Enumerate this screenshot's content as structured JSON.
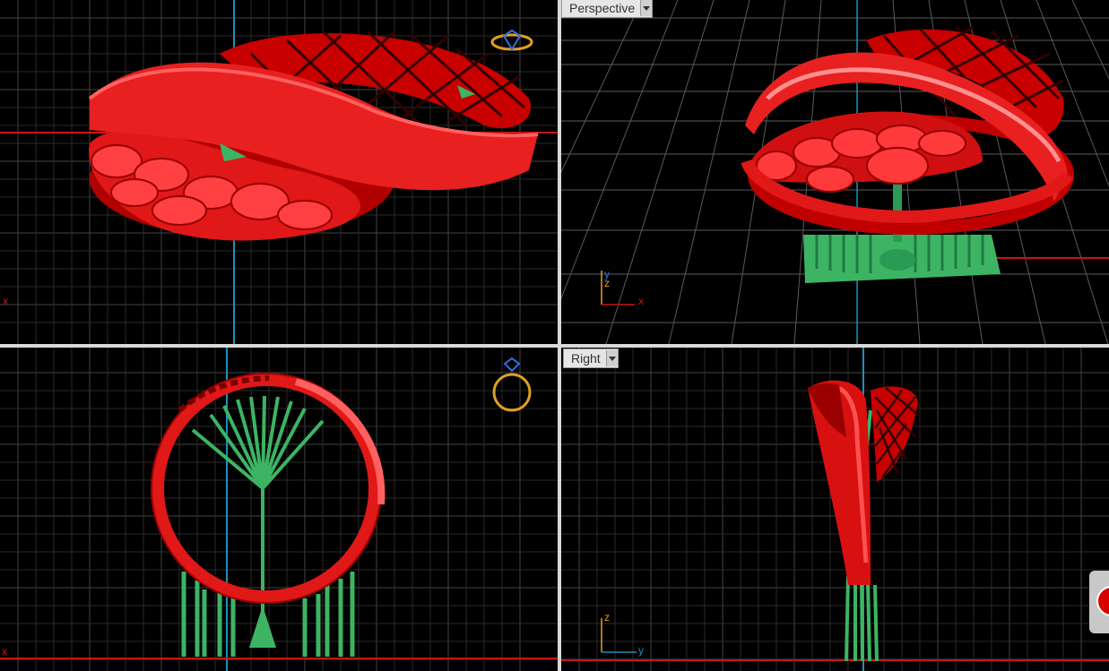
{
  "viewports": {
    "top": {
      "label": ""
    },
    "perspective": {
      "label": "Perspective"
    },
    "front": {
      "label": ""
    },
    "right": {
      "label": "Right"
    }
  },
  "axis_labels": {
    "persp_y": "y",
    "persp_z": "z",
    "persp_x": "x",
    "right_z": "z",
    "right_y": "y",
    "top_x": "x",
    "front_x": "x"
  },
  "colors": {
    "background": "#000000",
    "grid": "#4a4a4a",
    "model": "#e01010",
    "supports": "#3cb464",
    "accent_axis": "#1e8fb8",
    "axis_red": "#c81414",
    "gizmo_gold": "#e0a020",
    "gizmo_blue": "#3070e0"
  },
  "icons": {
    "viewport_menu": "chevron-down-icon",
    "gizmo": "ring-gizmo-icon",
    "side": "record-button-icon"
  }
}
